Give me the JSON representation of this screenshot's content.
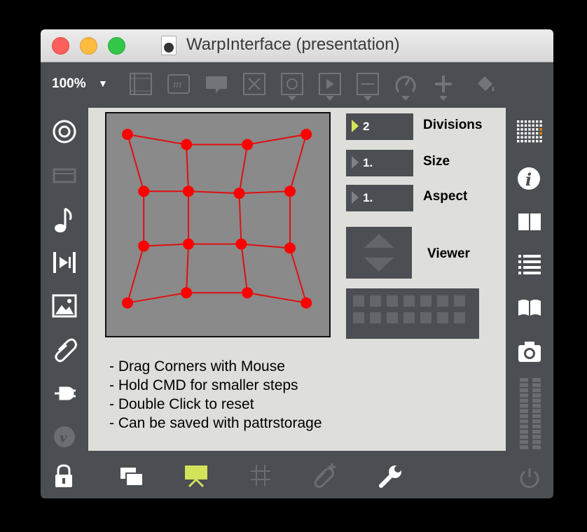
{
  "window": {
    "title": "WarpInterface (presentation)"
  },
  "toolbar": {
    "zoom_label": "100%",
    "zoom_arrow": "▼",
    "icons": [
      "presentation-frame-icon",
      "message-icon",
      "comment-icon",
      "close-box-icon",
      "toggle-icon",
      "play-icon",
      "slider-icon",
      "dial-icon",
      "plus-icon",
      "paint-bucket-icon"
    ]
  },
  "left_sidebar": {
    "icons": [
      "target-icon",
      "patcher-icon",
      "music-note-icon",
      "media-icon",
      "image-icon",
      "paperclip-icon",
      "plug-icon",
      "vimeo-icon"
    ]
  },
  "right_sidebar": {
    "icons": [
      "grid-icon",
      "info-icon",
      "book-split-icon",
      "list-icon",
      "open-book-icon",
      "camera-icon",
      "level-meter-icon",
      "power-icon"
    ]
  },
  "bottom_bar": {
    "icons": [
      "lock-icon",
      "windows-icon",
      "presentation-icon",
      "grid-hash-icon",
      "add-attachment-icon",
      "wrench-icon"
    ]
  },
  "controls": {
    "divisions": {
      "value": "2",
      "label": "Divisions"
    },
    "size": {
      "value": "1.",
      "label": "Size"
    },
    "aspect": {
      "value": "1.",
      "label": "Aspect"
    },
    "viewer": {
      "label": "Viewer"
    }
  },
  "instructions": [
    "- Drag Corners with Mouse",
    "- Hold CMD for smaller steps",
    "- Double Click to reset",
    "- Can be saved with pattrstorage"
  ],
  "colors": {
    "accent": "#d3e35a",
    "warp_lines": "#e01010",
    "warp_points": "#ff0000",
    "warp_background": "#8a8a8a"
  },
  "warp_grid": {
    "rows": [
      [
        [
          0.0,
          0.0
        ],
        [
          0.29,
          0.05
        ],
        [
          0.59,
          0.05
        ],
        [
          0.88,
          0.0
        ]
      ],
      [
        [
          0.08,
          0.28
        ],
        [
          0.3,
          0.28
        ],
        [
          0.55,
          0.29
        ],
        [
          0.8,
          0.28
        ]
      ],
      [
        [
          0.08,
          0.55
        ],
        [
          0.3,
          0.54
        ],
        [
          0.56,
          0.54
        ],
        [
          0.8,
          0.56
        ]
      ],
      [
        [
          0.0,
          0.83
        ],
        [
          0.29,
          0.78
        ],
        [
          0.59,
          0.78
        ],
        [
          0.88,
          0.83
        ]
      ]
    ]
  }
}
